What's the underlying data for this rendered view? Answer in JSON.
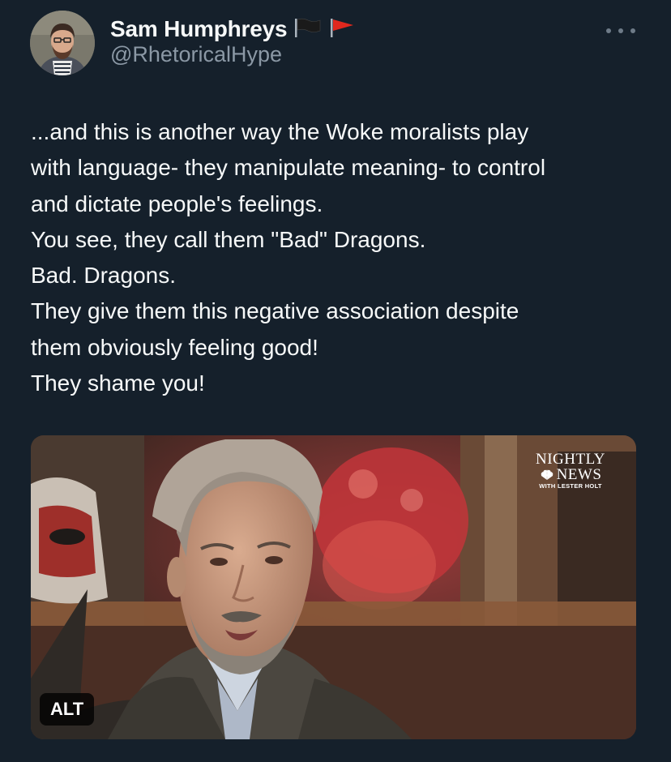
{
  "author": {
    "display_name": "Sam Humphreys",
    "handle": "@RhetoricalHype",
    "flags": [
      "black-flag-icon",
      "red-flag-icon"
    ]
  },
  "tweet": {
    "lines": [
      "...and this is another way the Woke moralists play",
      "with language- they manipulate meaning- to control",
      "and dictate people's feelings.",
      "You see, they call them \"Bad\" Dragons.",
      "Bad. Dragons.",
      "They give them this negative association despite",
      "them obviously feeling good!",
      "They shame you!"
    ]
  },
  "media": {
    "logo_line1": "NIGHTLY",
    "logo_line2": "NEWS",
    "logo_line3": "WITH LESTER HOLT",
    "alt_label": "ALT"
  },
  "colors": {
    "background": "#15202b",
    "primary_text": "#f7f9f9",
    "secondary_text": "#8b98a5"
  }
}
